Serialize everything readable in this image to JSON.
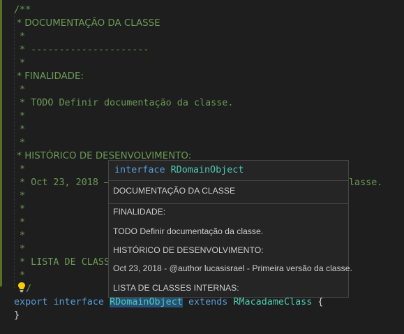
{
  "code": {
    "comment_open": "/**",
    "doc_title": " * DOCUMENTAÇÃO DA CLASSE",
    "star": " *",
    "separator": " * ---------------------",
    "finalidade": " * FINALIDADE:",
    "todo": " * TODO Definir documentação da classe.",
    "historico": " * HISTÓRICO DE DESENVOLVIMENTO:",
    "history_left": " * Oct 23, 2018 —",
    "history_right": "lasse.",
    "lista": " * LISTA DE CLASS",
    "comment_close": "/",
    "export_kw": "export",
    "interface_kw": "interface",
    "class_name": "RDomainObject",
    "extends_kw": "extends",
    "parent_name": "RMacadameClass",
    "open_brace": "{",
    "close_brace": "}"
  },
  "hover": {
    "sig_kw": "interface",
    "sig_name": "RDomainObject",
    "doc_title": "DOCUMENTAÇÃO DA CLASSE",
    "finalidade": "FINALIDADE:",
    "todo": "TODO Definir documentação da classe.",
    "historico": "HISTÓRICO DE DESENVOLVIMENTO:",
    "history_entry": "Oct 23, 2018 - @author lucasisrael - Primeira versão da classe.",
    "lista": "LISTA DE CLASSES INTERNAS:"
  },
  "icons": {
    "lightbulb": "lightbulb-icon"
  },
  "colors": {
    "comment": "#6a9955",
    "keyword": "#569cd6",
    "type": "#4ec9b0",
    "background": "#1e1e1e",
    "hover_background": "#252526"
  }
}
